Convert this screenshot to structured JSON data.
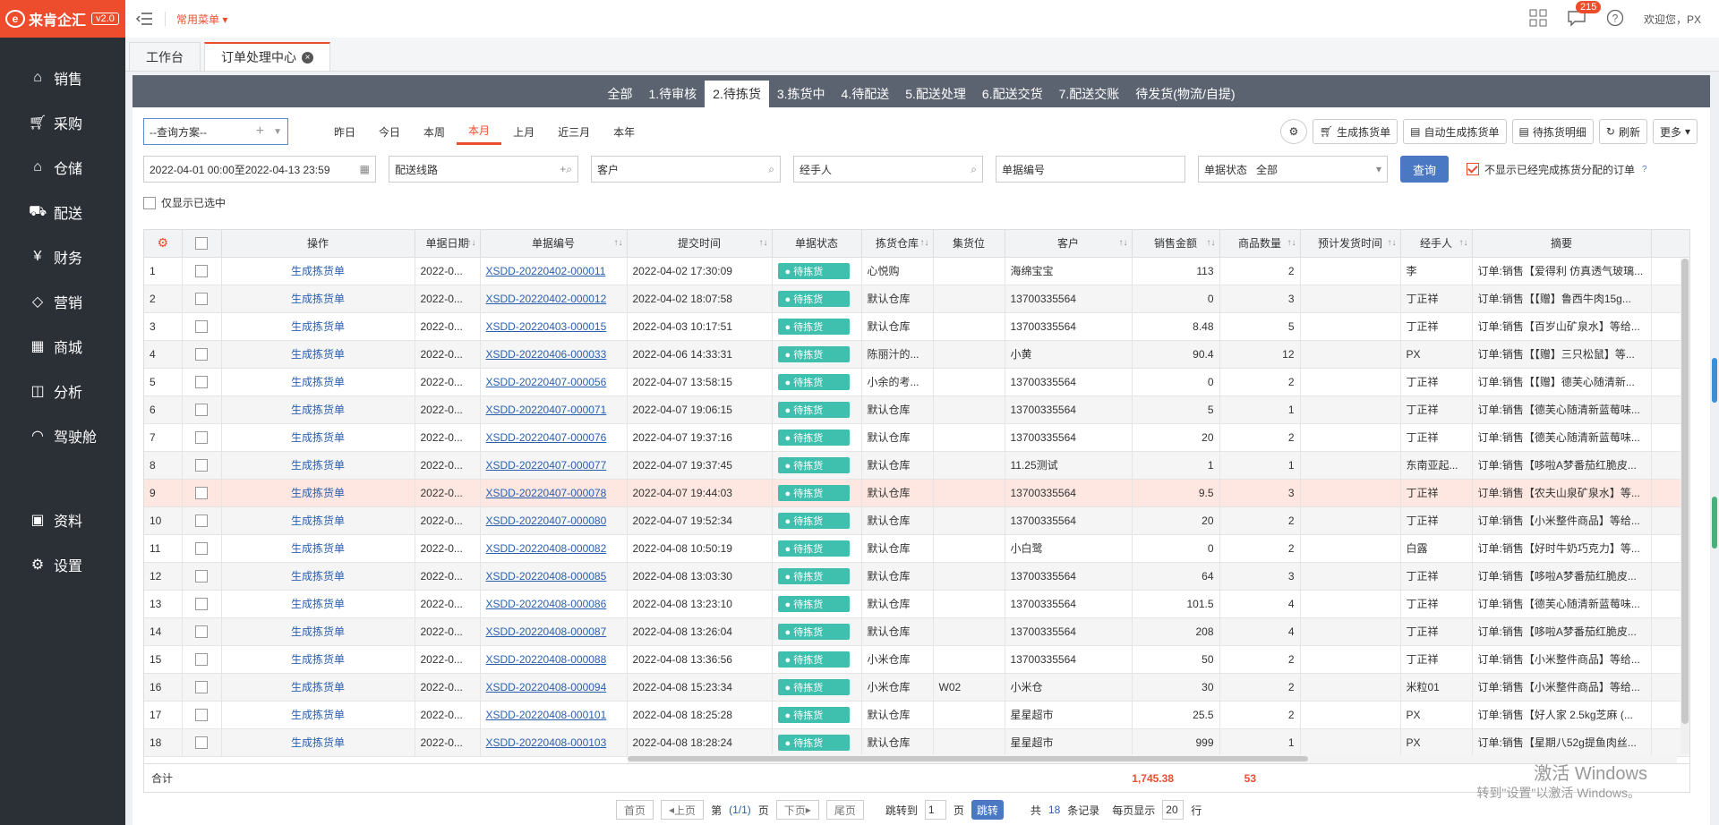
{
  "app": {
    "logo": "来肯企汇",
    "version": "v2.0"
  },
  "sidebar": {
    "items": [
      {
        "label": "销售",
        "icon": "tag-icon"
      },
      {
        "label": "采购",
        "icon": "cart-icon"
      },
      {
        "label": "仓储",
        "icon": "warehouse-icon"
      },
      {
        "label": "配送",
        "icon": "truck-icon"
      },
      {
        "label": "财务",
        "icon": "yen-icon"
      },
      {
        "label": "营销",
        "icon": "bag-icon"
      },
      {
        "label": "商城",
        "icon": "shop-icon"
      },
      {
        "label": "分析",
        "icon": "analysis-icon"
      },
      {
        "label": "驾驶舱",
        "icon": "dashboard-icon"
      }
    ],
    "bottom": [
      {
        "label": "资料",
        "icon": "archive-icon"
      },
      {
        "label": "设置",
        "icon": "gear-icon"
      }
    ]
  },
  "topbar": {
    "common_menu": "常用菜单",
    "badge": "215",
    "welcome": "欢迎您，PX"
  },
  "tabs": [
    {
      "label": "工作台"
    },
    {
      "label": "订单处理中心"
    }
  ],
  "status_tabs": [
    "全部",
    "1.待审核",
    "2.待拣货",
    "3.拣货中",
    "4.待配送",
    "5.配送处理",
    "6.配送交货",
    "7.配送交账",
    "待发货(物流/自提)"
  ],
  "filters": {
    "scheme": "--查询方案--",
    "date_ranges": [
      "昨日",
      "今日",
      "本周",
      "本月",
      "上月",
      "近三月",
      "本年"
    ],
    "date_value": "2022-04-01 00:00至2022-04-13 23:59",
    "route": "配送线路",
    "customer": "客户",
    "handler": "经手人",
    "bill_no": "单据编号",
    "bill_status_label": "单据状态",
    "bill_status_value": "全部",
    "query": "查询",
    "hide_done": "不显示已经完成拣货分配的订单",
    "only_selected": "仅显示已选中"
  },
  "toolbar": {
    "gen": "生成拣货单",
    "auto_gen": "自动生成拣货单",
    "detail": "待拣货明细",
    "refresh": "刷新",
    "more": "更多"
  },
  "table": {
    "headers": [
      "操作",
      "单据日期",
      "单据编号",
      "提交时间",
      "单据状态",
      "拣货仓库",
      "集货位",
      "客户",
      "销售金额",
      "商品数量",
      "预计发货时间",
      "经手人",
      "摘要"
    ],
    "action_label": "生成拣货单",
    "rows": [
      {
        "no": "1",
        "date": "2022-0...",
        "code": "XSDD-20220402-000011",
        "time": "2022-04-02 17:30:09",
        "status": "待拣货",
        "wh": "心悦购",
        "pos": "",
        "cust": "海绵宝宝",
        "amt": "113",
        "qty": "2",
        "eta": "",
        "handler": "李",
        "memo": "订单:销售【爱得利 仿真透气玻璃..."
      },
      {
        "no": "2",
        "date": "2022-0...",
        "code": "XSDD-20220402-000012",
        "time": "2022-04-02 18:07:58",
        "status": "待拣货",
        "wh": "默认仓库",
        "pos": "",
        "cust": "13700335564",
        "amt": "0",
        "qty": "3",
        "eta": "",
        "handler": "丁正祥",
        "memo": "订单:销售【【赠】鲁西牛肉15g..."
      },
      {
        "no": "3",
        "date": "2022-0...",
        "code": "XSDD-20220403-000015",
        "time": "2022-04-03 10:17:51",
        "status": "待拣货",
        "wh": "默认仓库",
        "pos": "",
        "cust": "13700335564",
        "amt": "8.48",
        "qty": "5",
        "eta": "",
        "handler": "丁正祥",
        "memo": "订单:销售【百岁山矿泉水】等给..."
      },
      {
        "no": "4",
        "date": "2022-0...",
        "code": "XSDD-20220406-000033",
        "time": "2022-04-06 14:33:31",
        "status": "待拣货",
        "wh": "陈丽汁的...",
        "pos": "",
        "cust": "小黄",
        "amt": "90.4",
        "qty": "12",
        "eta": "",
        "handler": "PX",
        "memo": "订单:销售【【赠】三只松鼠】等..."
      },
      {
        "no": "5",
        "date": "2022-0...",
        "code": "XSDD-20220407-000056",
        "time": "2022-04-07 13:58:15",
        "status": "待拣货",
        "wh": "小余的考...",
        "pos": "",
        "cust": "13700335564",
        "amt": "0",
        "qty": "2",
        "eta": "",
        "handler": "丁正祥",
        "memo": "订单:销售【【赠】德芙心随清新..."
      },
      {
        "no": "6",
        "date": "2022-0...",
        "code": "XSDD-20220407-000071",
        "time": "2022-04-07 19:06:15",
        "status": "待拣货",
        "wh": "默认仓库",
        "pos": "",
        "cust": "13700335564",
        "amt": "5",
        "qty": "1",
        "eta": "",
        "handler": "丁正祥",
        "memo": "订单:销售【德芙心随清新蓝莓味..."
      },
      {
        "no": "7",
        "date": "2022-0...",
        "code": "XSDD-20220407-000076",
        "time": "2022-04-07 19:37:16",
        "status": "待拣货",
        "wh": "默认仓库",
        "pos": "",
        "cust": "13700335564",
        "amt": "20",
        "qty": "2",
        "eta": "",
        "handler": "丁正祥",
        "memo": "订单:销售【德芙心随清新蓝莓味..."
      },
      {
        "no": "8",
        "date": "2022-0...",
        "code": "XSDD-20220407-000077",
        "time": "2022-04-07 19:37:45",
        "status": "待拣货",
        "wh": "默认仓库",
        "pos": "",
        "cust": "11.25测试",
        "amt": "1",
        "qty": "1",
        "eta": "",
        "handler": "东南亚起...",
        "memo": "订单:销售【哆啦A梦番茄红脆皮..."
      },
      {
        "no": "9",
        "date": "2022-0...",
        "code": "XSDD-20220407-000078",
        "time": "2022-04-07 19:44:03",
        "status": "待拣货",
        "wh": "默认仓库",
        "pos": "",
        "cust": "13700335564",
        "amt": "9.5",
        "qty": "3",
        "eta": "",
        "handler": "丁正祥",
        "memo": "订单:销售【农夫山泉矿泉水】等...",
        "hl": true
      },
      {
        "no": "10",
        "date": "2022-0...",
        "code": "XSDD-20220407-000080",
        "time": "2022-04-07 19:52:34",
        "status": "待拣货",
        "wh": "默认仓库",
        "pos": "",
        "cust": "13700335564",
        "amt": "20",
        "qty": "2",
        "eta": "",
        "handler": "丁正祥",
        "memo": "订单:销售【小米整件商品】等给..."
      },
      {
        "no": "11",
        "date": "2022-0...",
        "code": "XSDD-20220408-000082",
        "time": "2022-04-08 10:50:19",
        "status": "待拣货",
        "wh": "默认仓库",
        "pos": "",
        "cust": "小白鹭",
        "amt": "0",
        "qty": "2",
        "eta": "",
        "handler": "白露",
        "memo": "订单:销售【好时牛奶巧克力】等..."
      },
      {
        "no": "12",
        "date": "2022-0...",
        "code": "XSDD-20220408-000085",
        "time": "2022-04-08 13:03:30",
        "status": "待拣货",
        "wh": "默认仓库",
        "pos": "",
        "cust": "13700335564",
        "amt": "64",
        "qty": "3",
        "eta": "",
        "handler": "丁正祥",
        "memo": "订单:销售【哆啦A梦番茄红脆皮..."
      },
      {
        "no": "13",
        "date": "2022-0...",
        "code": "XSDD-20220408-000086",
        "time": "2022-04-08 13:23:10",
        "status": "待拣货",
        "wh": "默认仓库",
        "pos": "",
        "cust": "13700335564",
        "amt": "101.5",
        "qty": "4",
        "eta": "",
        "handler": "丁正祥",
        "memo": "订单:销售【德芙心随清新蓝莓味..."
      },
      {
        "no": "14",
        "date": "2022-0...",
        "code": "XSDD-20220408-000087",
        "time": "2022-04-08 13:26:04",
        "status": "待拣货",
        "wh": "默认仓库",
        "pos": "",
        "cust": "13700335564",
        "amt": "208",
        "qty": "4",
        "eta": "",
        "handler": "丁正祥",
        "memo": "订单:销售【哆啦A梦番茄红脆皮..."
      },
      {
        "no": "15",
        "date": "2022-0...",
        "code": "XSDD-20220408-000088",
        "time": "2022-04-08 13:36:56",
        "status": "待拣货",
        "wh": "小米仓库",
        "pos": "",
        "cust": "13700335564",
        "amt": "50",
        "qty": "2",
        "eta": "",
        "handler": "丁正祥",
        "memo": "订单:销售【小米整件商品】等给..."
      },
      {
        "no": "16",
        "date": "2022-0...",
        "code": "XSDD-20220408-000094",
        "time": "2022-04-08 15:23:34",
        "status": "待拣货",
        "wh": "小米仓库",
        "pos": "W02",
        "cust": "小米仓",
        "amt": "30",
        "qty": "2",
        "eta": "",
        "handler": "米粒01",
        "memo": "订单:销售【小米整件商品】等给..."
      },
      {
        "no": "17",
        "date": "2022-0...",
        "code": "XSDD-20220408-000101",
        "time": "2022-04-08 18:25:28",
        "status": "待拣货",
        "wh": "默认仓库",
        "pos": "",
        "cust": "星星超市",
        "amt": "25.5",
        "qty": "2",
        "eta": "",
        "handler": "PX",
        "memo": "订单:销售【好人家 2.5kg芝麻 (..."
      },
      {
        "no": "18",
        "date": "2022-0...",
        "code": "XSDD-20220408-000103",
        "time": "2022-04-08 18:28:24",
        "status": "待拣货",
        "wh": "默认仓库",
        "pos": "",
        "cust": "星星超市",
        "amt": "999",
        "qty": "1",
        "eta": "",
        "handler": "PX",
        "memo": "订单:销售【星期八52g提鱼肉丝..."
      }
    ],
    "total_label": "合计",
    "total_amt": "1,745.38",
    "total_qty": "53"
  },
  "pager": {
    "first": "首页",
    "prev": "上页",
    "page_prefix": "第",
    "page_val": "(1/1)",
    "page_suffix": "页",
    "next": "下页",
    "last": "尾页",
    "jump_prefix": "跳转到",
    "jump_val": "1",
    "jump_suffix": "页",
    "go": "跳转",
    "count_prefix": "共",
    "count": "18",
    "count_suffix": "条记录",
    "per_prefix": "每页显示",
    "per_val": "20",
    "per_suffix": "行"
  },
  "watermark": {
    "line1": "激活 Windows",
    "line2": "转到\"设置\"以激活 Windows。"
  }
}
